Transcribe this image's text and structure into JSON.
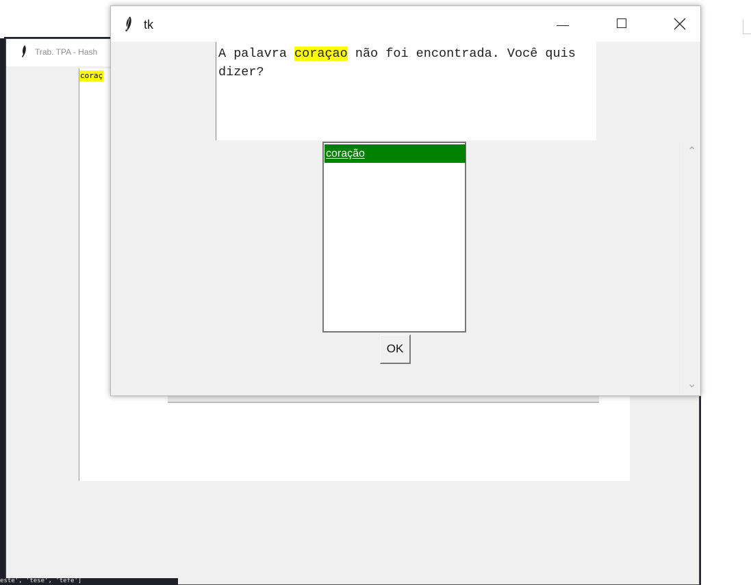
{
  "background_window": {
    "title": "Trab. TPA - Hash",
    "snippet": "coraç"
  },
  "dialog": {
    "title": "tk",
    "message": {
      "before": "A palavra ",
      "highlighted": "coraçao",
      "after": " não foi encontrada. Você quis dizer?"
    },
    "suggestions": [
      "coração"
    ],
    "ok_label": "OK",
    "controls": {
      "minimize_icon": "minimize-icon",
      "maximize_icon": "maximize-icon",
      "close_icon": "close-icon"
    }
  },
  "colors": {
    "highlight": "#ffff00",
    "selected_item": "#008000"
  },
  "console_text": "este', 'tese', 'tefe']"
}
